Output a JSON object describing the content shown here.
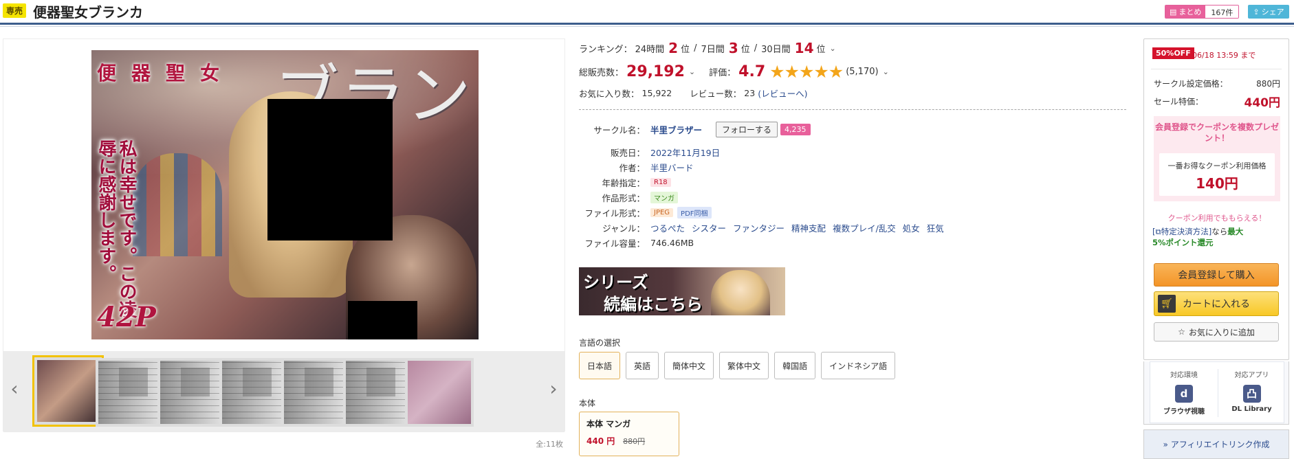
{
  "header": {
    "exclusive_badge": "専売",
    "title": "便器聖女ブランカ",
    "matome_label": "まとめ",
    "matome_count": "167件",
    "share_label": "シェア"
  },
  "cover": {
    "title_kanji": "便器聖女",
    "title_kana": "ブランカ",
    "tagline": "私は幸せです。この凌辱に感謝します。",
    "pages": "42P"
  },
  "gallery": {
    "prev_icon": "chevron-left-icon",
    "next_icon": "chevron-right-icon",
    "thumbnail_count": 7,
    "total": "全:11枚"
  },
  "ranking": {
    "label": "ランキング：",
    "h24_label": "24時間",
    "h24_value": "2",
    "d7_label": "7日間",
    "d7_value": "3",
    "d30_label": "30日間",
    "d30_value": "14",
    "unit": "位",
    "sep": "/"
  },
  "sales": {
    "label": "総販売数：",
    "value": "29,192",
    "rating_label": "評価：",
    "rating": "4.7",
    "stars": "★★★★★",
    "rating_count": "(5,170)",
    "favorites_label": "お気に入り数：",
    "favorites": "15,922",
    "reviews_label": "レビュー数：",
    "reviews": "23",
    "reviews_link": "(レビューへ)"
  },
  "details": {
    "circle_label": "サークル名：",
    "circle": "半里ブラザー",
    "follow_label": "フォローする",
    "follow_count": "4,235",
    "release_label": "販売日：",
    "release": "2022年11月19日",
    "author_label": "作者：",
    "author": "半里バード",
    "age_label": "年齢指定：",
    "age": "R18",
    "format_label": "作品形式：",
    "format": "マンガ",
    "file_label": "ファイル形式：",
    "file_jpeg": "JPEG",
    "file_pdf": "PDF同梱",
    "genre_label": "ジャンル：",
    "genres": [
      "つるぺた",
      "シスター",
      "ファンタジー",
      "精神支配",
      "複数プレイ/乱交",
      "処女",
      "狂気"
    ],
    "size_label": "ファイル容量：",
    "size": "746.46MB"
  },
  "series_banner": {
    "line1": "シリーズ",
    "line2": "続編はこちら"
  },
  "languages": {
    "title": "言語の選択",
    "options": [
      "日本語",
      "英語",
      "簡体中文",
      "繁体中文",
      "韓国語",
      "インドネシア語"
    ],
    "selected": "日本語"
  },
  "body": {
    "title": "本体",
    "card_name": "本体 マンガ",
    "price_now": "440",
    "price_was": "880",
    "yen": "円"
  },
  "purchase": {
    "off_badge": "50%OFF",
    "deadline": "06/18 13:59 まで",
    "list_price_label": "サークル設定価格：",
    "list_price": "880円",
    "sale_label": "セール特価：",
    "sale_price": "440円",
    "coupon_head": "会員登録でクーポンを複数プレゼント！",
    "coupon_best_label": "一番お得なクーポン利用価格",
    "coupon_price": "140円",
    "coupon_get": "クーポン利用でももらえる！",
    "pay_note_bracket_open": "[",
    "pay_note_link": "特定決済方法",
    "pay_note_bracket_close": "]",
    "pay_note_mid": "なら",
    "pay_note_max": "最大",
    "pay_note_points": "5%ポイント還元",
    "buy_label": "会員登録して購入",
    "cart_label": "カートに入れる",
    "fav_label": "お気に入りに追加"
  },
  "environment": {
    "env_title": "対応環境",
    "env_name": "ブラウザ視聴",
    "app_title": "対応アプリ",
    "app_name": "DL Library",
    "affiliate": "» アフィリエイトリンク作成"
  },
  "colors": {
    "accent_red": "#c0112b",
    "header_rule": "#3d5d8c",
    "star": "#f3a51a",
    "buy_orange": "#f39427",
    "cart_yellow": "#f8c826"
  }
}
